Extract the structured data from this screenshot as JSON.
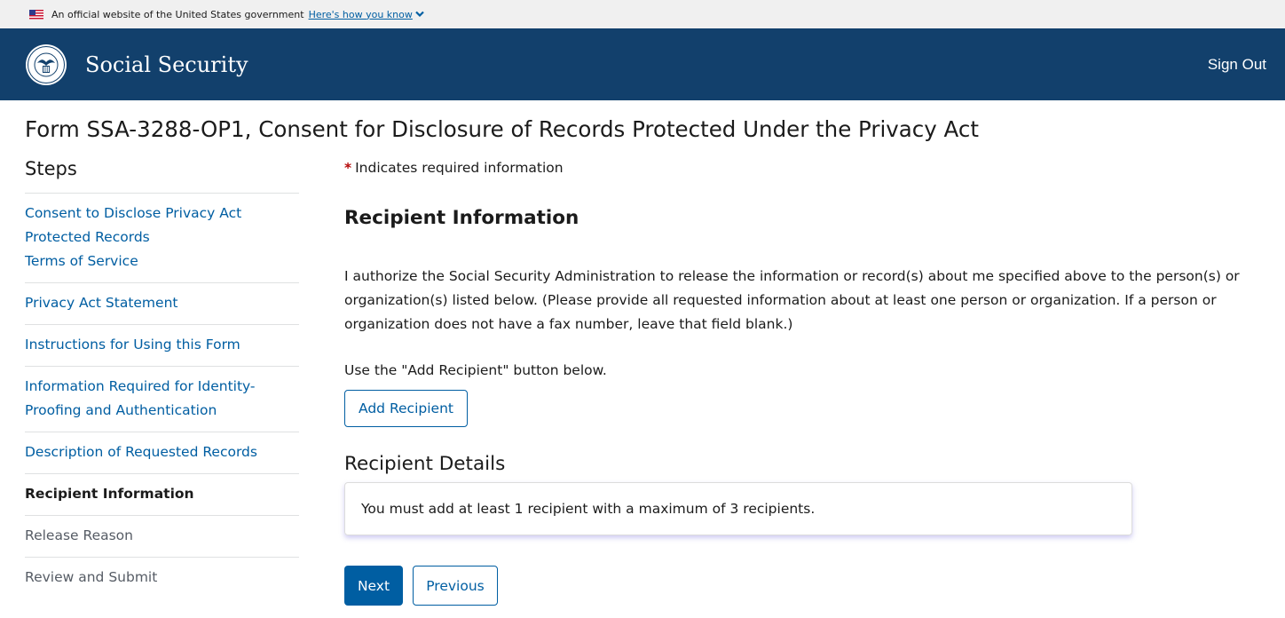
{
  "gov_banner": {
    "text": "An official website of the United States government",
    "link": "Here's how you know"
  },
  "header": {
    "site_title": "Social Security",
    "sign_out": "Sign Out",
    "brand_color": "#12406c"
  },
  "page_title": "Form SSA-3288-OP1, Consent for Disclosure of Records Protected Under the Privacy Act",
  "sidebar": {
    "heading": "Steps",
    "steps": [
      {
        "label": "Consent to Disclose Privacy Act Protected Records",
        "sub": "Terms of Service",
        "state": "link"
      },
      {
        "label": "Privacy Act Statement",
        "state": "link"
      },
      {
        "label": "Instructions for Using this Form",
        "state": "link"
      },
      {
        "label": "Information Required for Identity-Proofing and Authentication",
        "state": "link"
      },
      {
        "label": "Description of Requested Records",
        "state": "link"
      },
      {
        "label": "Recipient Information",
        "state": "current"
      },
      {
        "label": "Release Reason",
        "state": "future"
      },
      {
        "label": "Review and Submit",
        "state": "future"
      }
    ]
  },
  "main": {
    "required_star": "*",
    "required_note": "Indicates required information",
    "section_heading": "Recipient Information",
    "authorization_text": "I authorize the Social Security Administration to release the information or record(s) about me specified above to the person(s) or organization(s) listed below. (Please provide all requested information about at least one person or organization. If a person or organization does not have a fax number, leave that field blank.)",
    "use_note": "Use the \"Add Recipient\" button below.",
    "add_recipient_label": "Add Recipient",
    "details_heading": "Recipient Details",
    "details_message": "You must add at least 1 recipient with a maximum of 3 recipients.",
    "next_label": "Next",
    "previous_label": "Previous"
  },
  "colors": {
    "link": "#005ea2",
    "primary_button": "#005ea2",
    "required_star": "#b50909"
  }
}
